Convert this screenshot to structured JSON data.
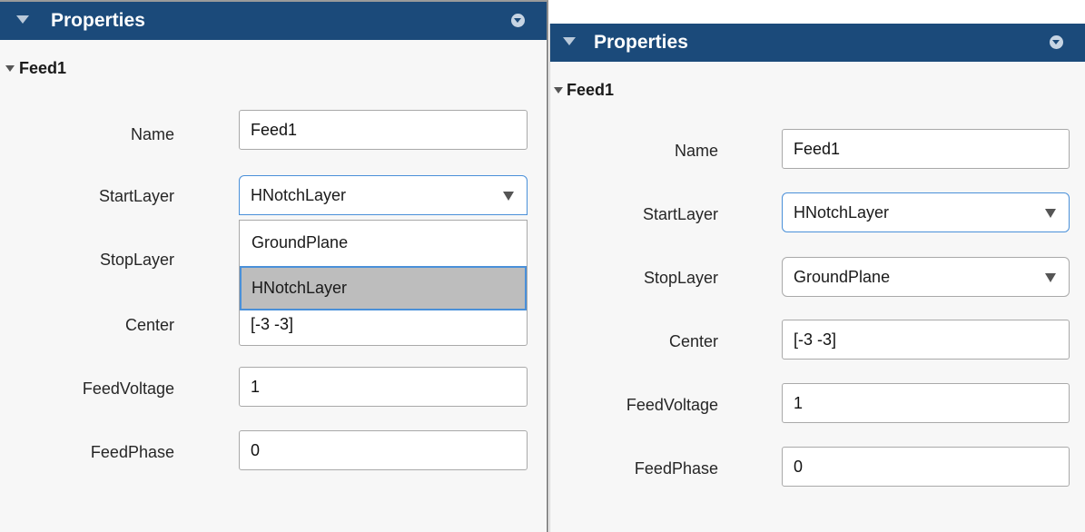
{
  "panels": [
    {
      "title": "Properties",
      "section": "Feed1",
      "fields": {
        "name": {
          "label": "Name",
          "value": "Feed1"
        },
        "start_layer": {
          "label": "StartLayer",
          "value": "HNotchLayer"
        },
        "stop_layer": {
          "label": "StopLayer"
        },
        "center": {
          "label": "Center",
          "value": "[-3 -3]"
        },
        "feed_voltage": {
          "label": "FeedVoltage",
          "value": "1"
        },
        "feed_phase": {
          "label": "FeedPhase",
          "value": "0"
        }
      },
      "dropdown_open": {
        "options": [
          "GroundPlane",
          "HNotchLayer"
        ],
        "selected": "HNotchLayer"
      }
    },
    {
      "title": "Properties",
      "section": "Feed1",
      "fields": {
        "name": {
          "label": "Name",
          "value": "Feed1"
        },
        "start_layer": {
          "label": "StartLayer",
          "value": "HNotchLayer"
        },
        "stop_layer": {
          "label": "StopLayer",
          "value": "GroundPlane"
        },
        "center": {
          "label": "Center",
          "value": "[-3 -3]"
        },
        "feed_voltage": {
          "label": "FeedVoltage",
          "value": "1"
        },
        "feed_phase": {
          "label": "FeedPhase",
          "value": "0"
        }
      }
    }
  ],
  "icons": {
    "collapse": "triangle-down-icon",
    "panel_menu": "circle-chevron-down-icon",
    "dropdown": "caret-down-icon"
  },
  "colors": {
    "titlebar": "#1b4a7a",
    "focus_border": "#4a90d9",
    "selected_option": "#bdbdbd"
  }
}
